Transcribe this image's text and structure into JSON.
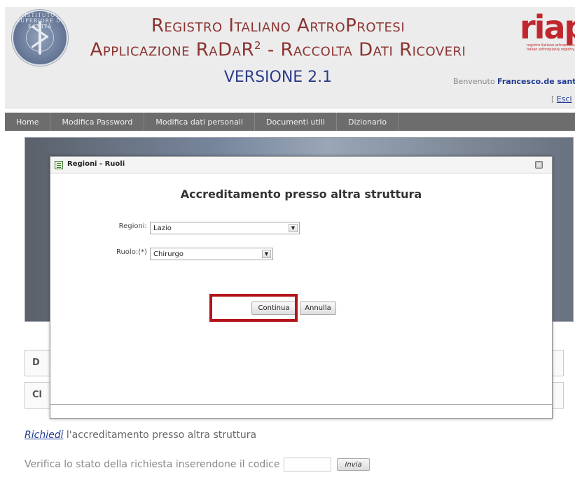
{
  "header": {
    "title_line1": "Registro Italiano ArtroProtesi",
    "title_line2_a": "Applicazione RaDaR",
    "title_line2_sup": "2",
    "title_line2_b": " - Raccolta Dati Ricoveri",
    "version": "VERSIONE 2.1",
    "seal_text": "ISTITUTO SUPERIORE DI SANITÀ",
    "logo_word": "riap",
    "logo_tagline1": "registro italiano artroprotesi",
    "logo_tagline2": "italian arthroplasty registry",
    "welcome_prefix": "Benvenuto ",
    "welcome_user": "Francesco.de santis",
    "logout_open": "[ ",
    "logout_label": "Esci",
    "logout_close": " ]"
  },
  "nav": {
    "items": [
      "Home",
      "Modifica Password",
      "Modifica dati personali",
      "Documenti utili",
      "Dizionario"
    ]
  },
  "background_boxes": {
    "d_letter": "D",
    "c_letter": "Cl"
  },
  "modal": {
    "title": "Regioni - Ruoli",
    "close_glyph": "⊠",
    "heading": "Accreditamento presso altra struttura",
    "regioni_label": "Regioni:",
    "regioni_value": "Lazio",
    "ruolo_label": "Ruolo:(*)",
    "ruolo_value": "Chirurgo",
    "continua_label": "Continua",
    "annulla_label": "Annulla"
  },
  "footer": {
    "request_link": "Richiedi",
    "request_text": " l'accreditamento presso altra struttura",
    "verify_text": "Verifica lo stato della richiesta inserendone il codice",
    "code_value": "",
    "invia_label": "Invia"
  },
  "colors": {
    "title": "#8a3431",
    "version": "#2d3c8a",
    "nav_bg": "#6d6d6d",
    "logo": "#c0262d",
    "highlight": "#b3141c"
  }
}
